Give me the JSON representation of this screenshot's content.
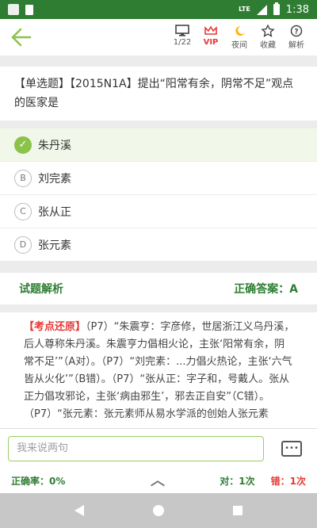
{
  "status_bar": {
    "lte": "LTE",
    "time": "1:38"
  },
  "toolbar": {
    "items": [
      {
        "icon": "monitor-icon",
        "label": "1/22"
      },
      {
        "icon": "crown-icon",
        "label": "VIP"
      },
      {
        "icon": "moon-icon",
        "label": "夜间"
      },
      {
        "icon": "star-icon",
        "label": "收藏"
      },
      {
        "icon": "help-circle-icon",
        "label": "解析"
      }
    ]
  },
  "question": {
    "text": "【单选题】【2015N1A】提出“阳常有余，阴常不足”观点的医家是"
  },
  "options": [
    {
      "letter": "A",
      "text": "朱丹溪",
      "correct": true
    },
    {
      "letter": "B",
      "text": "刘完素"
    },
    {
      "letter": "C",
      "text": "张从正"
    },
    {
      "letter": "D",
      "text": "张元素"
    }
  ],
  "analysis": {
    "title": "试题解析",
    "answer_label": "正确答案：A",
    "tag": "【考点还原】",
    "body": "（P7）“朱震亨：字彦修，世居浙江义乌丹溪，后人尊称朱丹溪。朱震亨力倡相火论，主张‘阳常有余，阴常不足’”（A对）。（P7）“刘完素：...力倡火热论，主张‘六气皆从火化’”（B错）。（P7）“张从正：字子和，号戴人。张从正力倡攻邪论，主张‘病由邪生’，邪去正自安”（C错）。（P7）“张元素：张元素师从易水学派的创始人张元素"
  },
  "comment": {
    "placeholder": "我来说两句"
  },
  "stats": {
    "accuracy": "正确率：0%",
    "right_count": "对：1次",
    "wrong_count": "错：1次"
  },
  "colors": {
    "primary_green": "#2e7d32",
    "accent_green": "#8bc34a",
    "error_red": "#e53935"
  }
}
